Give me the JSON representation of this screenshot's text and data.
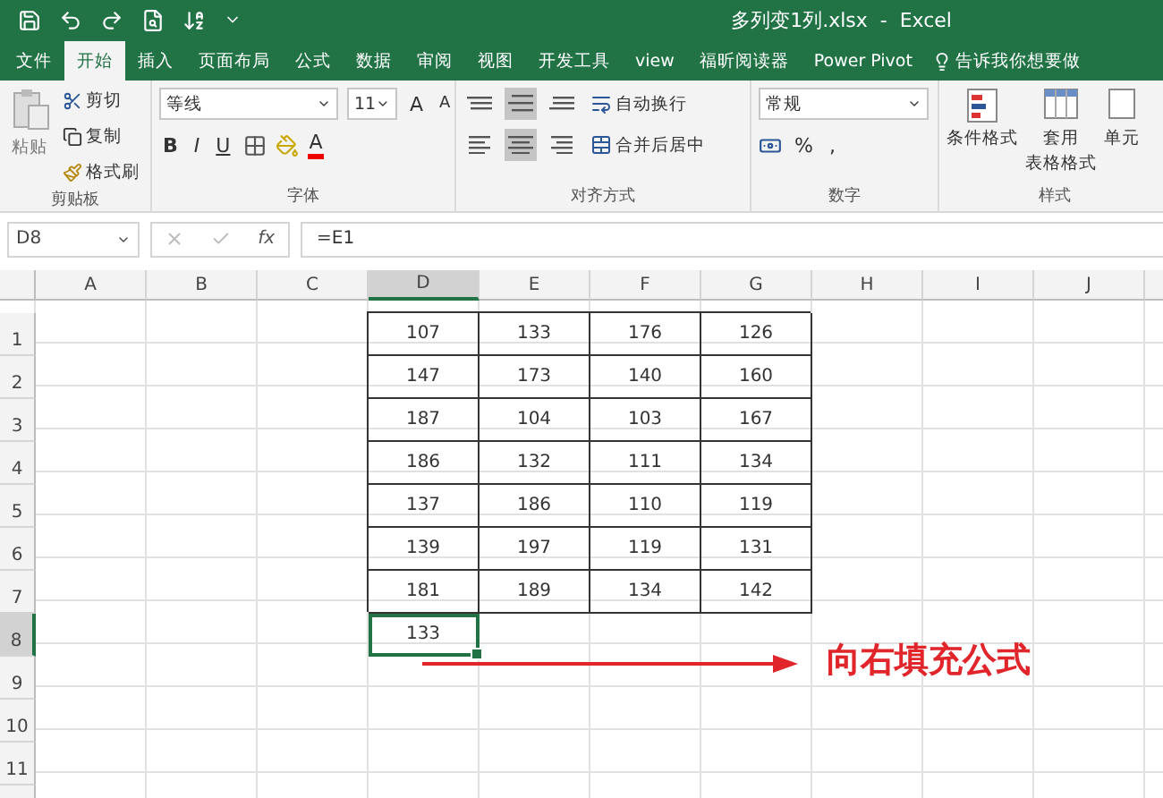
{
  "window": {
    "title": "多列变1列.xlsx  -  Excel"
  },
  "tabs": [
    {
      "label": "文件",
      "selected": false
    },
    {
      "label": "开始",
      "selected": true
    },
    {
      "label": "插入",
      "selected": false
    },
    {
      "label": "页面布局",
      "selected": false
    },
    {
      "label": "公式",
      "selected": false
    },
    {
      "label": "数据",
      "selected": false
    },
    {
      "label": "审阅",
      "selected": false
    },
    {
      "label": "视图",
      "selected": false
    },
    {
      "label": "开发工具",
      "selected": false
    },
    {
      "label": "view",
      "selected": false
    },
    {
      "label": "福昕阅读器",
      "selected": false
    },
    {
      "label": "Power Pivot",
      "selected": false
    }
  ],
  "tell_me": {
    "label": "告诉我你想要做"
  },
  "ribbon": {
    "clipboard": {
      "label": "剪贴板",
      "paste": "粘贴",
      "cut": "剪切",
      "copy": "复制",
      "format_painter": "格式刷"
    },
    "font": {
      "label": "字体",
      "font_name": "等线",
      "font_size": "11",
      "grow": "A",
      "shrink": "A",
      "bold": "B",
      "italic": "I",
      "underline": "U",
      "font_color": "A"
    },
    "alignment": {
      "label": "对齐方式",
      "wrap_text": "自动换行",
      "merge_center": "合并后居中",
      "vertical": [
        {
          "kind": "top",
          "selected": false
        },
        {
          "kind": "middle",
          "selected": true
        },
        {
          "kind": "bottom",
          "selected": false
        }
      ],
      "horizontal": [
        {
          "kind": "left",
          "selected": false
        },
        {
          "kind": "center",
          "selected": true
        },
        {
          "kind": "right",
          "selected": false
        }
      ]
    },
    "number": {
      "label": "数字",
      "format": "常规",
      "percent": "%",
      "comma": ","
    },
    "styles": {
      "label": "样式",
      "conditional": "条件格式",
      "table_format": [
        "套用",
        "表格格式"
      ],
      "cell_styles": "单元"
    }
  },
  "formula_bar": {
    "name_box": "D8",
    "fx": "fx",
    "formula": "=E1"
  },
  "sheet": {
    "columns": [
      {
        "label": "A",
        "selected": false
      },
      {
        "label": "B",
        "selected": false
      },
      {
        "label": "C",
        "selected": false
      },
      {
        "label": "D",
        "selected": true
      },
      {
        "label": "E",
        "selected": false
      },
      {
        "label": "F",
        "selected": false
      },
      {
        "label": "G",
        "selected": false
      },
      {
        "label": "H",
        "selected": false
      },
      {
        "label": "I",
        "selected": false
      },
      {
        "label": "J",
        "selected": false
      }
    ],
    "rows": [
      {
        "label": "1",
        "selected": false,
        "cells": [
          "",
          "",
          "",
          "107",
          "133",
          "176",
          "126"
        ]
      },
      {
        "label": "2",
        "selected": false,
        "cells": [
          "",
          "",
          "",
          "147",
          "173",
          "140",
          "160"
        ]
      },
      {
        "label": "3",
        "selected": false,
        "cells": [
          "",
          "",
          "",
          "187",
          "104",
          "103",
          "167"
        ]
      },
      {
        "label": "4",
        "selected": false,
        "cells": [
          "",
          "",
          "",
          "186",
          "132",
          "111",
          "134"
        ]
      },
      {
        "label": "5",
        "selected": false,
        "cells": [
          "",
          "",
          "",
          "137",
          "186",
          "110",
          "119"
        ]
      },
      {
        "label": "6",
        "selected": false,
        "cells": [
          "",
          "",
          "",
          "139",
          "197",
          "119",
          "131"
        ]
      },
      {
        "label": "7",
        "selected": false,
        "cells": [
          "",
          "",
          "",
          "181",
          "189",
          "134",
          "142"
        ]
      },
      {
        "label": "8",
        "selected": true,
        "cells": [
          "",
          "",
          "",
          "133"
        ]
      },
      {
        "label": "9",
        "selected": false
      },
      {
        "label": "10",
        "selected": false
      },
      {
        "label": "11",
        "selected": false
      }
    ]
  },
  "annotation": {
    "text": "向右填充公式"
  }
}
